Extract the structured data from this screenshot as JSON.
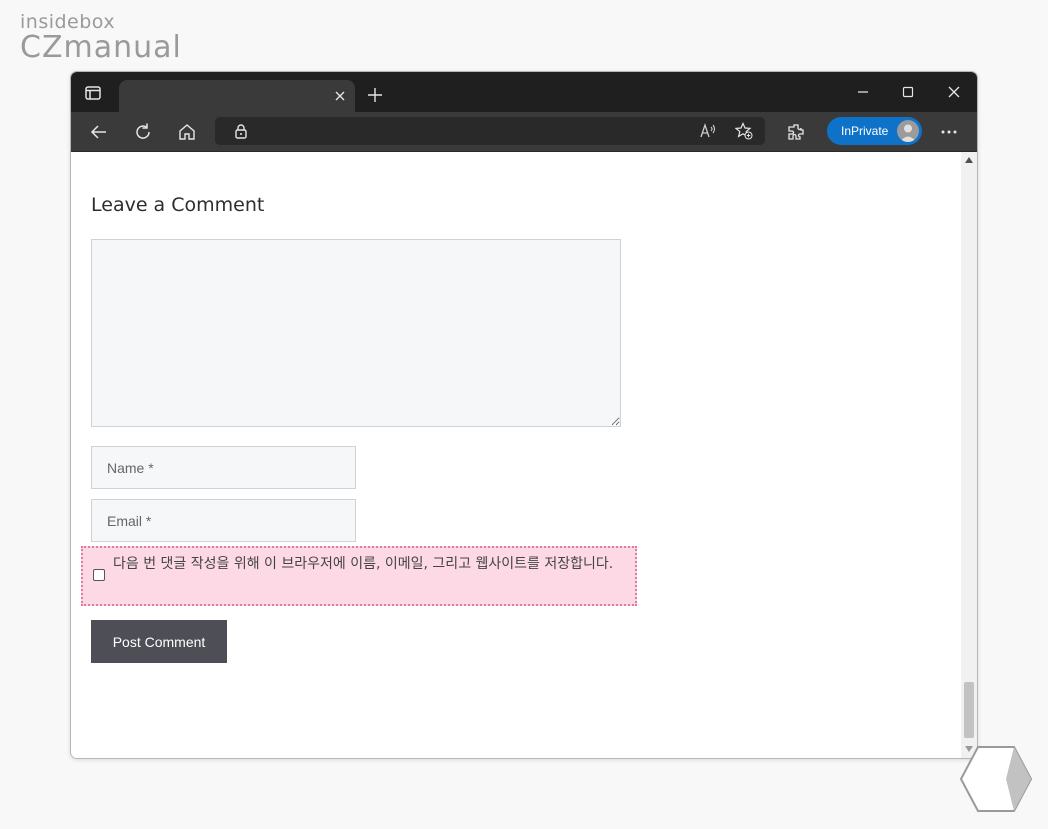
{
  "brand": {
    "line1": "insidebox",
    "line2": "CZmanual"
  },
  "browser": {
    "tab_close_icon": "close-icon",
    "new_tab_icon": "plus-icon",
    "inprivate_label": "InPrivate",
    "colors": {
      "tabbar": "#1f1f1f",
      "toolbar": "#3a3a3a",
      "inprivate": "#0f72c9"
    }
  },
  "page": {
    "title": "Leave a Comment",
    "comment": {
      "value": "",
      "placeholder": ""
    },
    "name_placeholder": "Name *",
    "email_placeholder": "Email *",
    "consent_text": "다음 번 댓글 작성을 위해 이 브라우저에 이름, 이메일, 그리고 웹사이트를 저장합니다.",
    "consent_checked": false,
    "submit_label": "Post Comment",
    "colors": {
      "submit_bg": "#4d4e56",
      "consent_highlight": "#fdd8e5"
    }
  }
}
